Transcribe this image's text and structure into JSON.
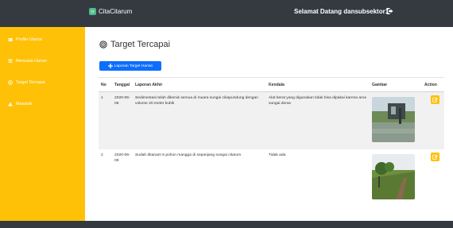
{
  "topbar": {
    "brand": "CitaCitarum",
    "welcome": "Selamat Datang dansubsektor1",
    "logout_icon": "logout-icon"
  },
  "sidebar": {
    "items": [
      {
        "label": "Profile Utama",
        "icon": "profile-icon"
      },
      {
        "label": "Rencana Harian",
        "icon": "plan-icon"
      },
      {
        "label": "Target Tercapai",
        "icon": "target-icon"
      },
      {
        "label": "Masalah",
        "icon": "warning-icon"
      }
    ]
  },
  "main": {
    "title": "Target Tercapai",
    "add_button": "Laporan Target Harian",
    "table": {
      "headers": [
        "No",
        "Tanggal",
        "Laporan Akhir",
        "Kendala",
        "Gambar",
        "Action"
      ],
      "rows": [
        {
          "no": "1",
          "date": "2020-06-06",
          "report": "Sedimentasi telah dikeruk semua di muara sungai cikapundung dengan volume 20 meter kubik",
          "issue": "Alat berat yang digunakan tidak bisa dipakai karena arus sungai deras"
        },
        {
          "no": "2",
          "date": "2020-06-09",
          "report": "Sudah ditanam 5 pohon mangga di sepanjang sungai citarum",
          "issue": "Tidak ada"
        }
      ]
    }
  },
  "colors": {
    "topbar": "#343a40",
    "sidebar": "#ffc107",
    "primary": "#0d6efd",
    "action": "#ffc107",
    "row_alt": "#f1f1f1"
  }
}
